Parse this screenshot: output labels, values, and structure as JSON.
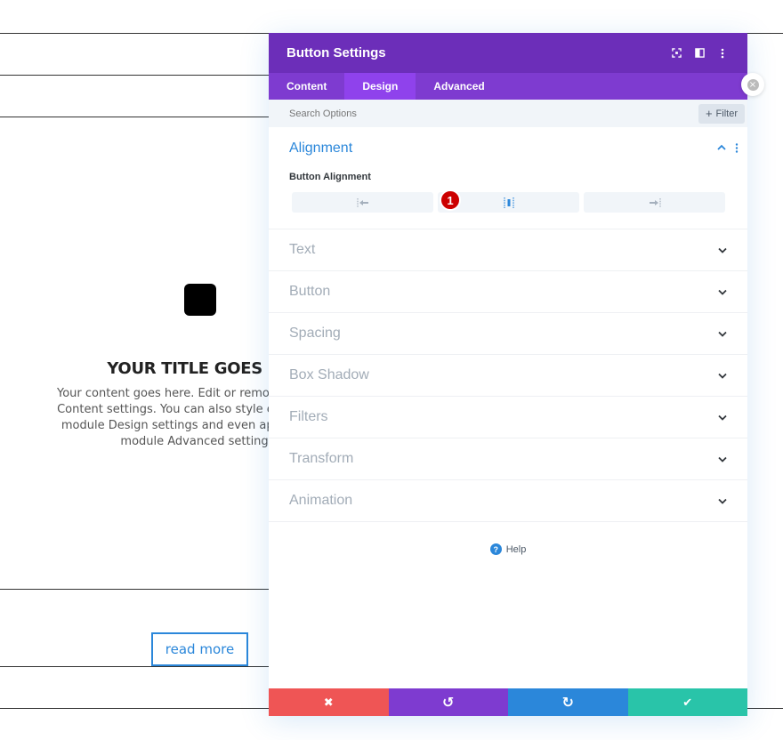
{
  "background": {
    "title": "YOUR TITLE GOES HE",
    "body_lines": [
      "Your content goes here. Edit or remove this text i",
      "Content settings. You can also style every aspect",
      "module Design settings and even apply custom",
      "module Advanced settings."
    ],
    "button_label": "read more"
  },
  "modal": {
    "title": "Button Settings",
    "tabs": [
      {
        "label": "Content"
      },
      {
        "label": "Design"
      },
      {
        "label": "Advanced"
      }
    ],
    "active_tab": "Design",
    "search_placeholder": "Search Options",
    "filter_label": "Filter",
    "open_section": {
      "title": "Alignment",
      "option_label": "Button Alignment",
      "options": [
        "left",
        "center",
        "right"
      ],
      "badge": "1"
    },
    "sections": [
      {
        "title": "Text"
      },
      {
        "title": "Button"
      },
      {
        "title": "Spacing"
      },
      {
        "title": "Box Shadow"
      },
      {
        "title": "Filters"
      },
      {
        "title": "Transform"
      },
      {
        "title": "Animation"
      }
    ],
    "help_label": "Help",
    "footer": {
      "cancel": "✖",
      "undo": "↺",
      "redo": "↻",
      "save": "✔"
    }
  },
  "colors": {
    "header": "#6c2eb9",
    "tabs": "#7e3bd0",
    "active_tab": "#8f42ec",
    "accent": "#2b87da",
    "cancel": "#ef5555",
    "undo": "#7e3bd0",
    "redo": "#2b87da",
    "save": "#29c4a9"
  }
}
